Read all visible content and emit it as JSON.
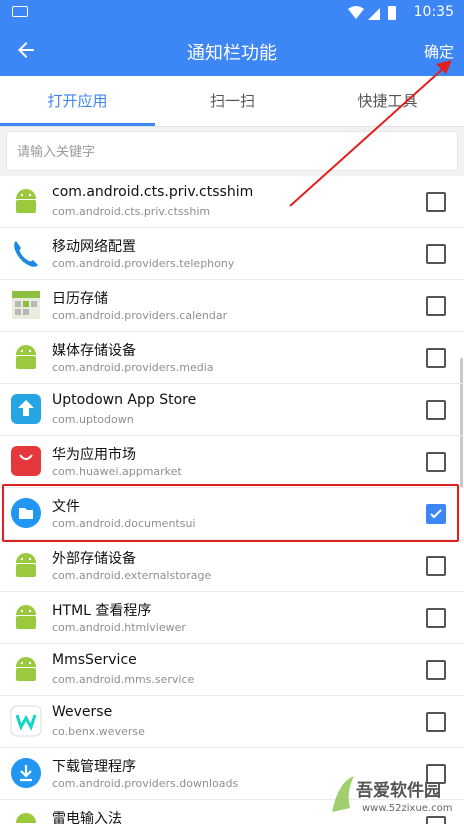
{
  "status_bar": {
    "time": "10:35"
  },
  "app_bar": {
    "title": "通知栏功能",
    "confirm_label": "确定"
  },
  "tabs": [
    {
      "label": "打开应用",
      "active": true
    },
    {
      "label": "扫一扫",
      "active": false
    },
    {
      "label": "快捷工具",
      "active": false
    }
  ],
  "search": {
    "placeholder": "请输入关键字",
    "value": ""
  },
  "apps": [
    {
      "name": "com.android.cts.priv.ctsshim",
      "package": "com.android.cts.priv.ctsshim",
      "icon": "android-icon",
      "checked": false
    },
    {
      "name": "移动网络配置",
      "package": "com.android.providers.telephony",
      "icon": "phone-icon",
      "checked": false
    },
    {
      "name": "日历存储",
      "package": "com.android.providers.calendar",
      "icon": "calendar-storage-icon",
      "checked": false
    },
    {
      "name": "媒体存储设备",
      "package": "com.android.providers.media",
      "icon": "android-icon",
      "checked": false
    },
    {
      "name": "Uptodown App Store",
      "package": "com.uptodown",
      "icon": "uptodown-icon",
      "checked": false
    },
    {
      "name": "华为应用市场",
      "package": "com.huawei.appmarket",
      "icon": "huawei-appmarket-icon",
      "checked": false
    },
    {
      "name": "文件",
      "package": "com.android.documentsui",
      "icon": "folder-icon",
      "checked": true
    },
    {
      "name": "外部存储设备",
      "package": "com.android.externalstorage",
      "icon": "android-icon",
      "checked": false
    },
    {
      "name": "HTML 查看程序",
      "package": "com.android.htmlviewer",
      "icon": "android-icon",
      "checked": false
    },
    {
      "name": "MmsService",
      "package": "com.android.mms.service",
      "icon": "android-icon",
      "checked": false
    },
    {
      "name": "Weverse",
      "package": "co.benx.weverse",
      "icon": "weverse-icon",
      "checked": false
    },
    {
      "name": "下载管理程序",
      "package": "com.android.providers.downloads",
      "icon": "download-icon",
      "checked": false
    },
    {
      "name": "雷电输入法",
      "package": "",
      "icon": "android-icon",
      "checked": false
    }
  ],
  "watermark": {
    "text": "吾爱软件园",
    "url": "www.52zixue.com"
  },
  "colors": {
    "primary": "#3d86f5",
    "annotation": "#e02020"
  }
}
